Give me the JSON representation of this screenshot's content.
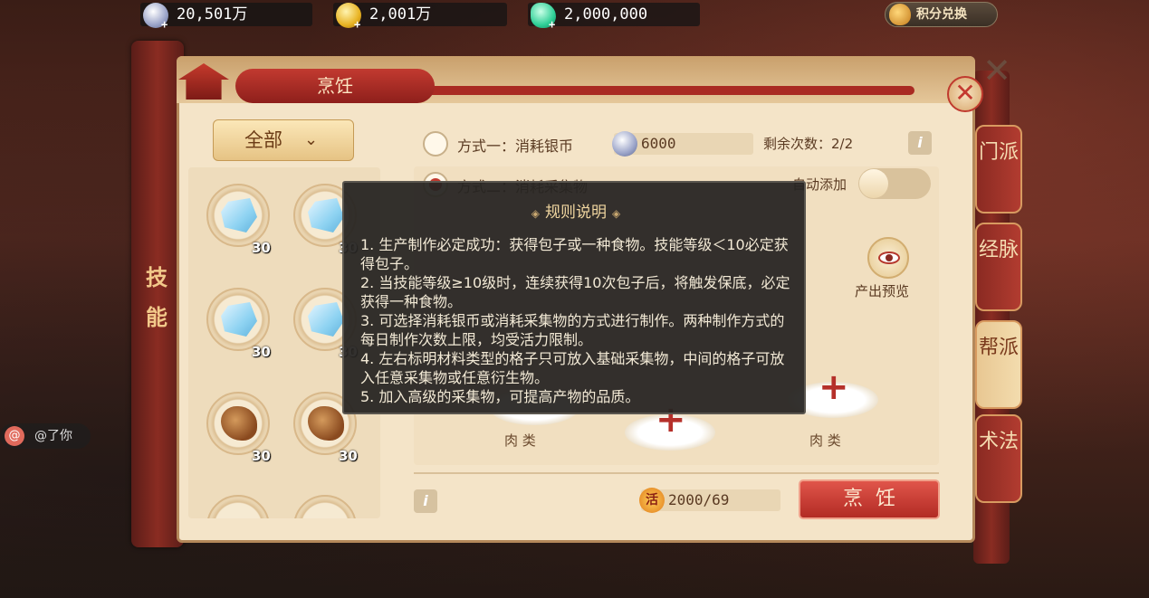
{
  "currencies": [
    {
      "value": "20,501万",
      "icon": "silver-coin-icon"
    },
    {
      "value": "2,001万",
      "icon": "gold-coin-icon"
    },
    {
      "value": "2,000,000",
      "icon": "jade-icon"
    }
  ],
  "points_button": "积分兑换",
  "rail_label": "技能",
  "title": "烹饪",
  "side_tabs": [
    "门派",
    "经脉",
    "帮派",
    "术法"
  ],
  "filter": {
    "label": "全部"
  },
  "items": [
    {
      "type": "ice",
      "count": "30"
    },
    {
      "type": "ice",
      "count": "30"
    },
    {
      "type": "ice",
      "count": "30"
    },
    {
      "type": "ice",
      "count": "30"
    },
    {
      "type": "meat",
      "count": "30"
    },
    {
      "type": "meat",
      "count": "30"
    }
  ],
  "mode1": {
    "label": "方式一：消耗银币",
    "cost": "6000",
    "remain": "剩余次数：2/2"
  },
  "mode2": {
    "label": "方式二：消耗采集物"
  },
  "auto_add_label": "自动添加",
  "preview_label": "产出预览",
  "slots": [
    {
      "label": "肉 类"
    },
    {
      "label": "肉 类"
    }
  ],
  "vigor": {
    "icon_text": "活",
    "value": "2000/69"
  },
  "cook_button": "烹饪",
  "tooltip": {
    "title": "规则说明",
    "lines": [
      "1. 生产制作必定成功：获得包子或一种食物。技能等级＜10必定获得包子。",
      "2. 当技能等级≥10级时，连续获得10次包子后，将触发保底，必定获得一种食物。",
      "3. 可选择消耗银币或消耗采集物的方式进行制作。两种制作方式的每日制作次数上限，均受活力限制。",
      "4. 左右标明材料类型的格子只可放入基础采集物，中间的格子可放入任意采集物或任意衍生物。",
      "5. 加入高级的采集物，可提高产物的品质。"
    ]
  },
  "chat": {
    "text": "@了你",
    "at": "@"
  }
}
